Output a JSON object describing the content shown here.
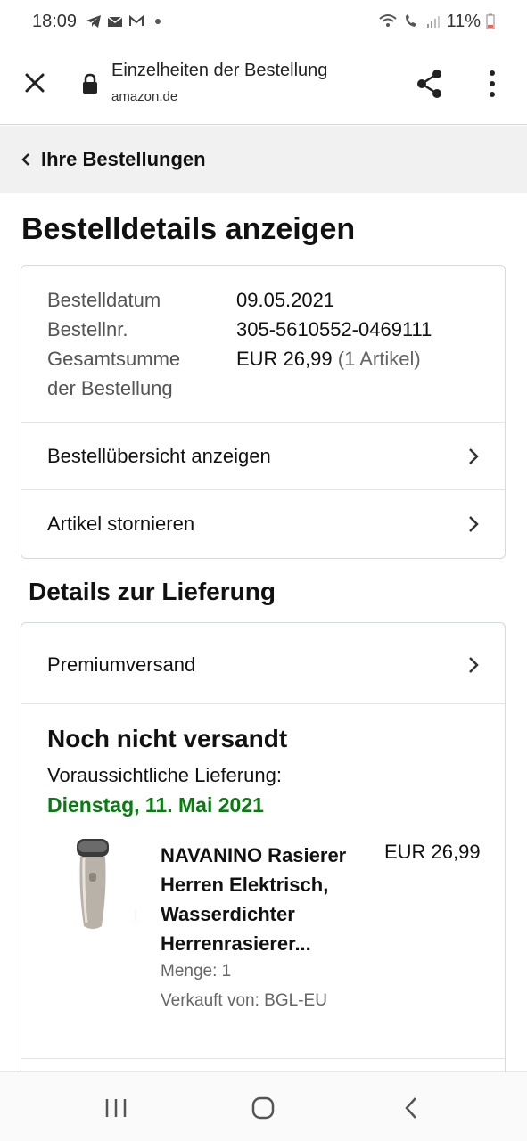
{
  "status_bar": {
    "time": "18:09",
    "battery": "11%"
  },
  "browser": {
    "title": "Einzelheiten der Bestellung",
    "url": "amazon.de"
  },
  "breadcrumb": {
    "back_label": "Ihre Bestellungen"
  },
  "page": {
    "title": "Bestelldetails anzeigen"
  },
  "order_info": {
    "date_label": "Bestelldatum",
    "date_value": "09.05.2021",
    "number_label": "Bestellnr.",
    "number_value": "305-5610552-0469111",
    "total_label_line1": "Gesamtsumme",
    "total_label_line2": "der Bestellung",
    "total_value": "EUR 26,99",
    "total_items": "(1 Artikel)"
  },
  "order_actions": {
    "summary_label": "Bestellübersicht anzeigen",
    "cancel_label": "Artikel stornieren"
  },
  "delivery": {
    "section_title": "Details zur Lieferung",
    "shipping_method": "Premiumversand",
    "status": "Noch nicht versandt",
    "expected_label": "Voraussichtliche Lieferung:",
    "expected_date": "Dienstag, 11. Mai 2021",
    "colors": {
      "date_green": "#067d0f"
    }
  },
  "product": {
    "name_line1": "NAVANINO Rasierer",
    "name_line2": "Herren Elektrisch,",
    "name_line3": "Wasserdichter",
    "name_line4": "Herrenrasierer...",
    "price": "EUR 26,99",
    "quantity": "Menge: 1",
    "seller": "Verkauft von: BGL-EU",
    "image_icon": "electric-shaver-image"
  }
}
